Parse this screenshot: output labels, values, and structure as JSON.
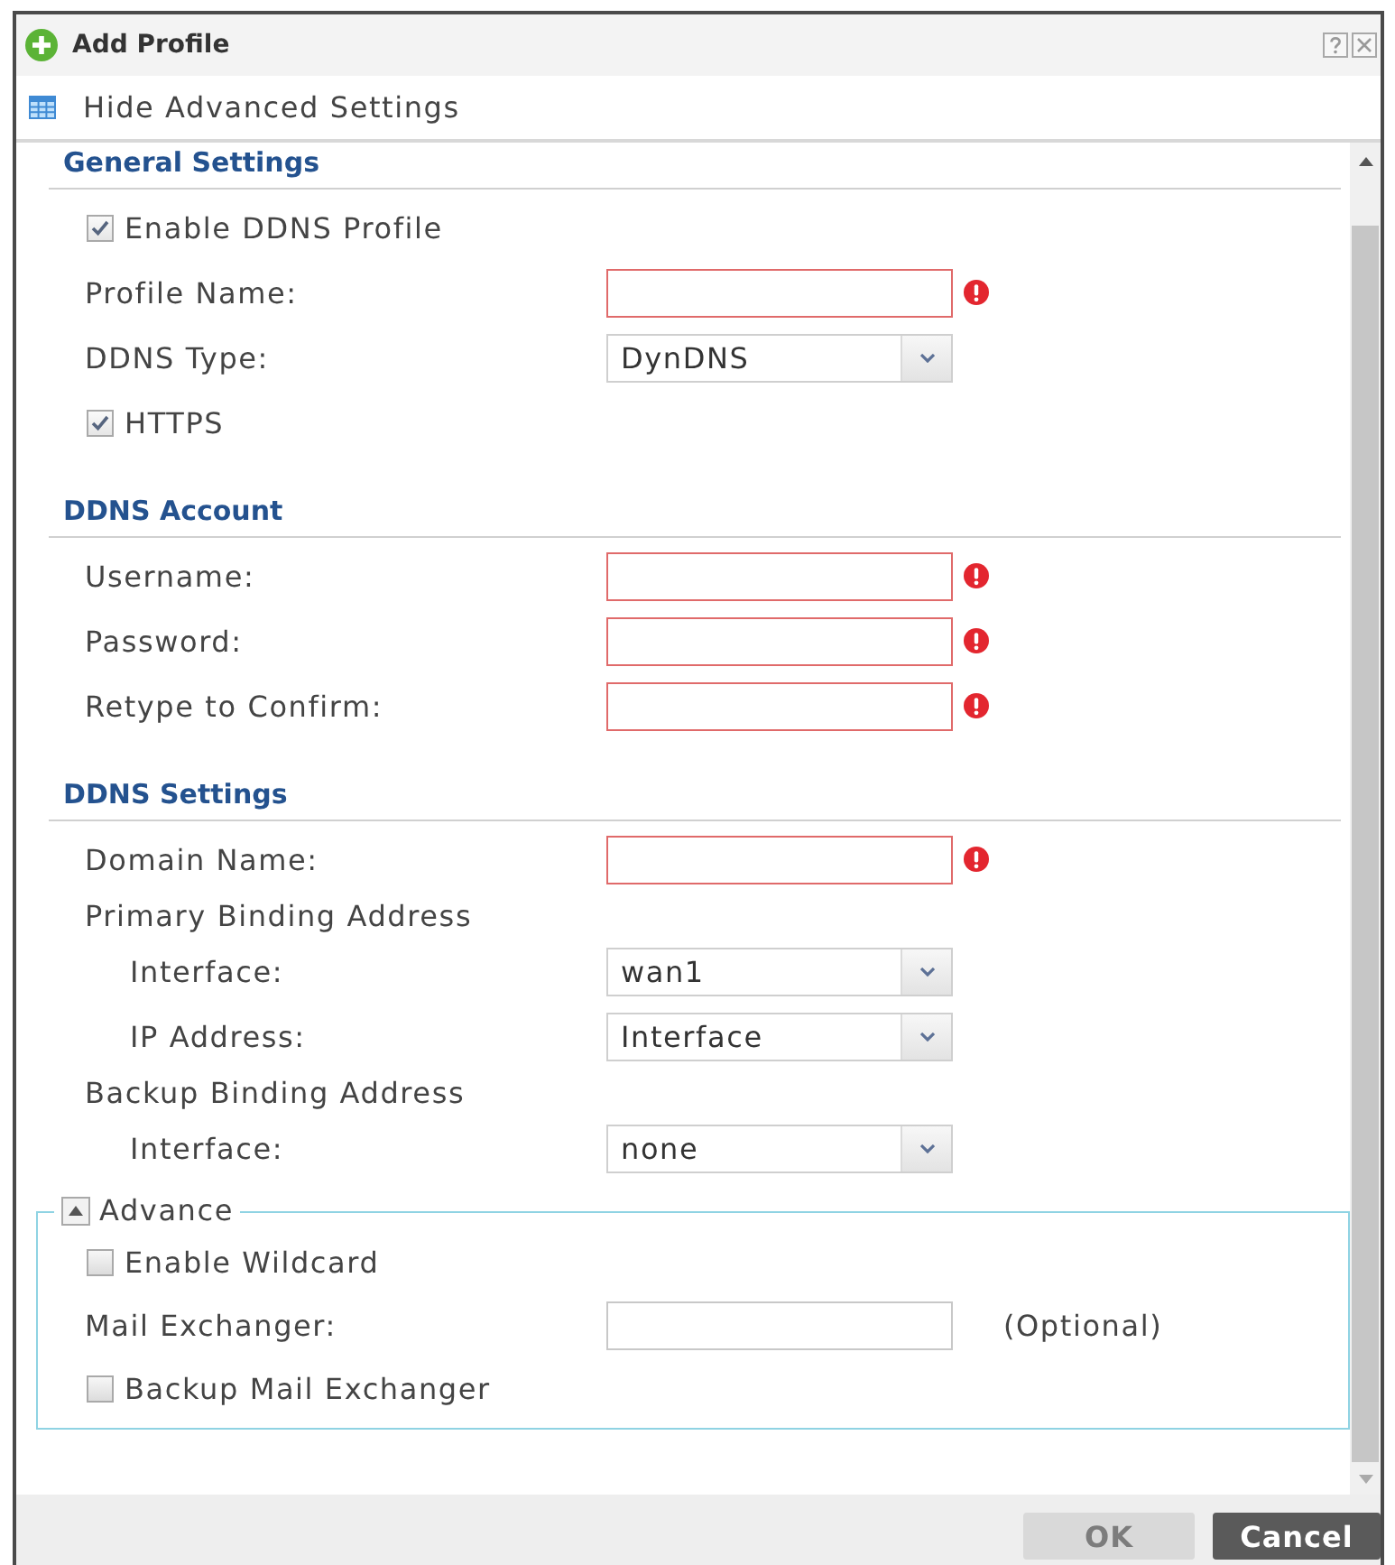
{
  "window": {
    "title": "Add Profile"
  },
  "toolbar": {
    "label": "Hide Advanced Settings"
  },
  "sections": [
    {
      "title": "General Settings",
      "rows": [
        {
          "kind": "checkbox",
          "label": "Enable DDNS Profile",
          "checked": true
        },
        {
          "kind": "input",
          "label": "Profile Name:",
          "required": true
        },
        {
          "kind": "select",
          "label": "DDNS Type:",
          "value": "DynDNS"
        },
        {
          "kind": "checkbox",
          "label": "HTTPS",
          "checked": true
        }
      ]
    },
    {
      "title": "DDNS Account",
      "rows": [
        {
          "kind": "input",
          "label": "Username:",
          "required": true
        },
        {
          "kind": "input",
          "label": "Password:",
          "required": true
        },
        {
          "kind": "input",
          "label": "Retype to Confirm:",
          "required": true
        }
      ]
    },
    {
      "title": "DDNS Settings",
      "rows": [
        {
          "kind": "input",
          "label": "Domain Name:",
          "required": true
        },
        {
          "kind": "group",
          "label": "Primary Binding Address",
          "children": [
            {
              "kind": "select",
              "label": "Interface:",
              "value": "wan1"
            },
            {
              "kind": "select",
              "label": "IP Address:",
              "value": "Interface"
            }
          ]
        },
        {
          "kind": "group",
          "label": "Backup Binding Address",
          "children": [
            {
              "kind": "select",
              "label": "Interface:",
              "value": "none"
            }
          ]
        }
      ]
    }
  ],
  "advance": {
    "title": "Advance",
    "expanded": true,
    "rows": [
      {
        "kind": "checkbox",
        "label": "Enable Wildcard",
        "checked": false
      },
      {
        "kind": "input",
        "label": "Mail Exchanger:",
        "required": false,
        "note": "(Optional)"
      },
      {
        "kind": "checkbox",
        "label": "Backup Mail Exchanger",
        "checked": false
      }
    ]
  },
  "buttons": [
    {
      "label": "OK",
      "disabled": true
    },
    {
      "label": "Cancel",
      "disabled": false
    }
  ]
}
